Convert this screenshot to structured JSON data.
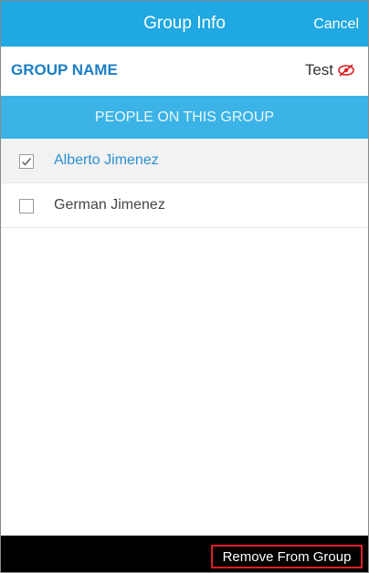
{
  "header": {
    "title": "Group Info",
    "cancel_label": "Cancel"
  },
  "group": {
    "name_label": "GROUP NAME",
    "name_value": "Test",
    "visibility_icon": "eye-off-icon"
  },
  "section": {
    "label": "PEOPLE ON THIS GROUP"
  },
  "members": [
    {
      "name": "Alberto Jimenez",
      "checked": true
    },
    {
      "name": "German Jimenez",
      "checked": false
    }
  ],
  "footer": {
    "remove_label": "Remove From Group"
  },
  "colors": {
    "header_bg": "#1fa8e1",
    "section_bg": "#3bb3e6",
    "accent_text": "#1c7fc6",
    "selected_text": "#2a8fd3",
    "icon_red": "#e21d23",
    "footer_bg": "#000000"
  }
}
